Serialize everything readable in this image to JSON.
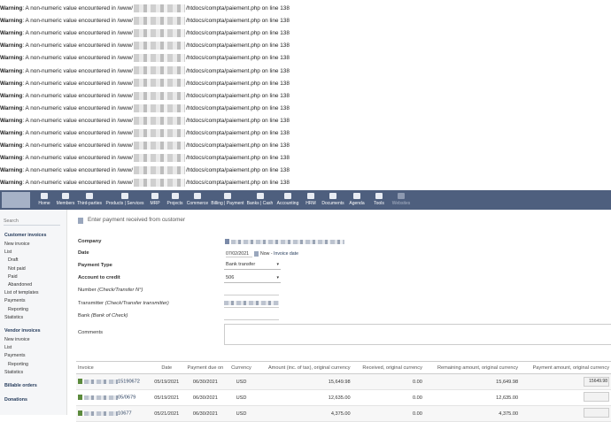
{
  "warnings": {
    "prefix": "Warning",
    "message_start": ": A non-numeric value encountered in /www/",
    "message_end": "/htdocs/compta/paiement.php on line 138",
    "count": 15
  },
  "menu": {
    "items": [
      {
        "label": "Home",
        "icon": "home-icon"
      },
      {
        "label": "Members",
        "icon": "members-icon"
      },
      {
        "label": "Third-parties",
        "icon": "building-icon"
      },
      {
        "label": "Products | Services",
        "icon": "cube-icon"
      },
      {
        "label": "MRP",
        "icon": "cubes-icon"
      },
      {
        "label": "Projects",
        "icon": "project-icon"
      },
      {
        "label": "Commerce",
        "icon": "suitcase-icon"
      },
      {
        "label": "Billing | Payment",
        "icon": "invoice-icon"
      },
      {
        "label": "Banks | Cash",
        "icon": "bank-icon"
      },
      {
        "label": "Accounting",
        "icon": "ledger-icon"
      },
      {
        "label": "HRM",
        "icon": "user-tie-icon"
      },
      {
        "label": "Documents",
        "icon": "folder-icon"
      },
      {
        "label": "Agenda",
        "icon": "calendar-icon"
      },
      {
        "label": "Tools",
        "icon": "wrench-icon"
      },
      {
        "label": "Websites",
        "icon": "globe-icon"
      }
    ]
  },
  "sidebar": {
    "search_placeholder": "Search",
    "items": [
      {
        "label": "Customer invoices",
        "kind": "head"
      },
      {
        "label": "New invoice",
        "kind": "item"
      },
      {
        "label": "List",
        "kind": "item"
      },
      {
        "label": "Draft",
        "kind": "sub"
      },
      {
        "label": "Not paid",
        "kind": "sub"
      },
      {
        "label": "Paid",
        "kind": "sub"
      },
      {
        "label": "Abandoned",
        "kind": "sub"
      },
      {
        "label": "List of templates",
        "kind": "item"
      },
      {
        "label": "Payments",
        "kind": "item"
      },
      {
        "label": "Reporting",
        "kind": "sub"
      },
      {
        "label": "Statistics",
        "kind": "item"
      },
      {
        "label": "Vendor invoices",
        "kind": "head"
      },
      {
        "label": "New invoice",
        "kind": "item"
      },
      {
        "label": "List",
        "kind": "item"
      },
      {
        "label": "Payments",
        "kind": "item"
      },
      {
        "label": "Reporting",
        "kind": "sub"
      },
      {
        "label": "Statistics",
        "kind": "item"
      },
      {
        "label": "Billable orders",
        "kind": "head"
      },
      {
        "label": "Donations",
        "kind": "head"
      }
    ]
  },
  "page": {
    "title": "Enter payment received from customer",
    "fields": {
      "company_label": "Company",
      "date_label": "Date",
      "date_value": "07/02/2021",
      "now_label": "Now",
      "invoice_date_label": "Invoice date",
      "payment_type_label": "Payment Type",
      "payment_type_value": "Bank transfer",
      "account_label": "Account to credit",
      "account_value": "506",
      "number_label": "Number",
      "number_hint": "(Check/Transfer N°)",
      "transmitter_label": "Transmitter",
      "transmitter_hint": "(Check/Transfer transmitter)",
      "bank_label": "Bank",
      "bank_hint": "(Bank of Check)",
      "comments_label": "Comments"
    }
  },
  "table": {
    "headers": [
      "Invoice",
      "Date",
      "Payment due on",
      "Currency",
      "Amount (inc. of tax), original currency",
      "Received, original currency",
      "Remaining amount, original currency",
      "Payment amount, original currency"
    ],
    "rows": [
      {
        "invoice_suffix": "15190672",
        "date": "05/19/2021",
        "due": "06/30/2021",
        "currency": "USD",
        "amount": "15,649.98",
        "received": "0.00",
        "remaining": "15,649.98",
        "payment": "15649.98"
      },
      {
        "invoice_suffix": "05/0679",
        "date": "05/19/2021",
        "due": "06/30/2021",
        "currency": "USD",
        "amount": "12,635.00",
        "received": "0.00",
        "remaining": "12,635.00",
        "payment": ""
      },
      {
        "invoice_suffix": "10677",
        "date": "05/21/2021",
        "due": "06/30/2021",
        "currency": "USD",
        "amount": "4,375.00",
        "received": "0.00",
        "remaining": "4,375.00",
        "payment": ""
      }
    ]
  }
}
